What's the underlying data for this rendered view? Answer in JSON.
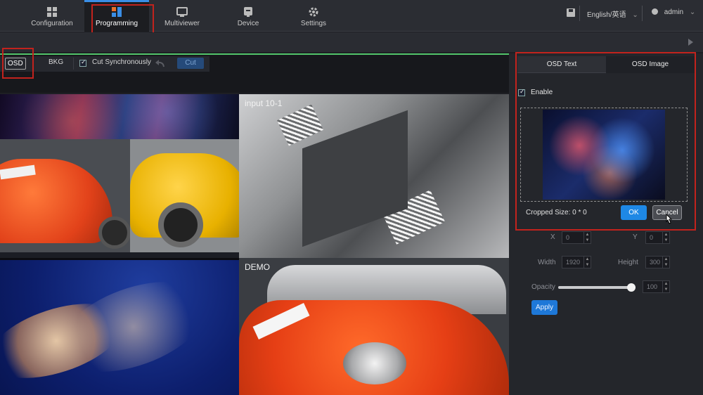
{
  "nav": {
    "items": [
      {
        "label": "Configuration",
        "icon": "grid-icon"
      },
      {
        "label": "Programming",
        "icon": "programming-icon",
        "active": true
      },
      {
        "label": "Multiviewer",
        "icon": "monitor-icon"
      },
      {
        "label": "Device",
        "icon": "device-icon"
      },
      {
        "label": "Settings",
        "icon": "gear-icon"
      }
    ],
    "language": "English/英语",
    "user": "admin"
  },
  "toolbar": {
    "osd": "OSD",
    "bkg": "BKG",
    "cut_sync": "Cut Synchronously",
    "cut_sync_checked": true,
    "cut": "Cut"
  },
  "preview": {
    "window_top_right_label": "input 10-1",
    "window_bottom_right_label": "DEMO"
  },
  "panel": {
    "tabs": [
      "OSD Text",
      "OSD Image"
    ],
    "active_tab": "OSD Image",
    "enable_label": "Enable",
    "enable_checked": true,
    "cropped_size": "Cropped Size: 0 * 0",
    "ok": "OK",
    "cancel": "Cancel",
    "x_label": "X",
    "x_value": "0",
    "y_label": "Y",
    "y_value": "0",
    "width_label": "Width",
    "width_value": "1920",
    "height_label": "Height",
    "height_value": "300",
    "opacity_label": "Opacity",
    "opacity_value": "100",
    "opacity_fraction": 1.0,
    "apply": "Apply"
  },
  "colors": {
    "accent": "#1e88e5",
    "highlight_box": "#c2231d",
    "active_line": "#52c46a"
  }
}
